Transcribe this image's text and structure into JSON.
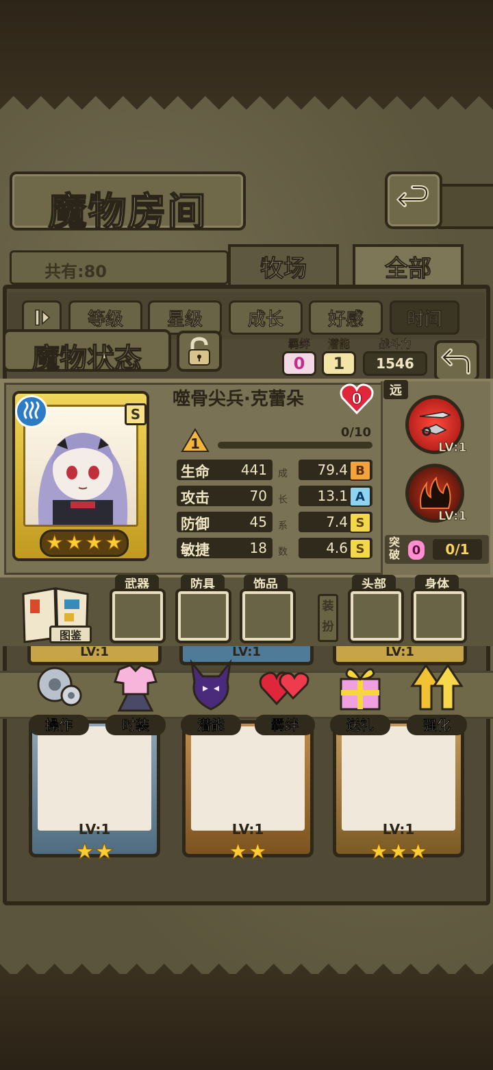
{
  "header": {
    "title": "魔物房间",
    "count_text": "共有:80",
    "tabs": [
      {
        "label": "牧场",
        "selected": false
      },
      {
        "label": "全部",
        "selected": true
      }
    ]
  },
  "sort": {
    "buttons": [
      "等级",
      "星级",
      "成长",
      "好感",
      "时间"
    ]
  },
  "status": {
    "title": "魔物状态",
    "bond": {
      "label": "羁绊",
      "value": "0"
    },
    "potential": {
      "label": "潜能",
      "value": "1"
    },
    "power": {
      "label": "战斗力",
      "value": "1546"
    }
  },
  "character": {
    "name": "噬骨尖兵·克蕾朵",
    "heart_value": "0",
    "rank": "S",
    "stars": 4,
    "level": "1",
    "exp_text": "0/10",
    "exp_fraction": 0,
    "stats": [
      {
        "name": "生命",
        "value": "441",
        "growth": "79.4",
        "grade": "B"
      },
      {
        "name": "攻击",
        "value": "70",
        "growth": "13.1",
        "grade": "A"
      },
      {
        "name": "防御",
        "value": "45",
        "growth": "7.4",
        "grade": "S"
      },
      {
        "name": "敏捷",
        "value": "18",
        "growth": "4.6",
        "grade": "S"
      }
    ],
    "growth_label": [
      "成",
      "长",
      "系",
      "数"
    ]
  },
  "skills": {
    "range": "远",
    "items": [
      {
        "icon": "throwing-knives-icon",
        "level": "LV:1",
        "color": "#e0302a"
      },
      {
        "icon": "dark-flame-icon",
        "level": "LV:1",
        "color": "#6a1a10"
      }
    ],
    "breakthrough_label": "突破",
    "breakthrough_badge": "0",
    "breakthrough_value": "0/1"
  },
  "equipment": {
    "book_label": "图鉴",
    "slots": [
      "武器",
      "防具",
      "饰品",
      "头部",
      "身体"
    ],
    "outfit_label": "装扮"
  },
  "actions": [
    {
      "label": "操作",
      "icon": "gear-icon"
    },
    {
      "label": "时装",
      "icon": "costume-icon"
    },
    {
      "label": "潜能",
      "icon": "demon-silhouette-icon"
    },
    {
      "label": "羁绊",
      "icon": "hearts-icon"
    },
    {
      "label": "送礼",
      "icon": "gift-icon"
    },
    {
      "label": "强化",
      "icon": "up-arrows-icon"
    }
  ],
  "monster_cards": [
    {
      "level": "LV:1",
      "stars": 2
    },
    {
      "level": "LV:1",
      "stars": 2
    },
    {
      "level": "LV:1",
      "stars": 3
    }
  ],
  "partial_cards": [
    "LV:1",
    "LV:1",
    "LV:1"
  ]
}
